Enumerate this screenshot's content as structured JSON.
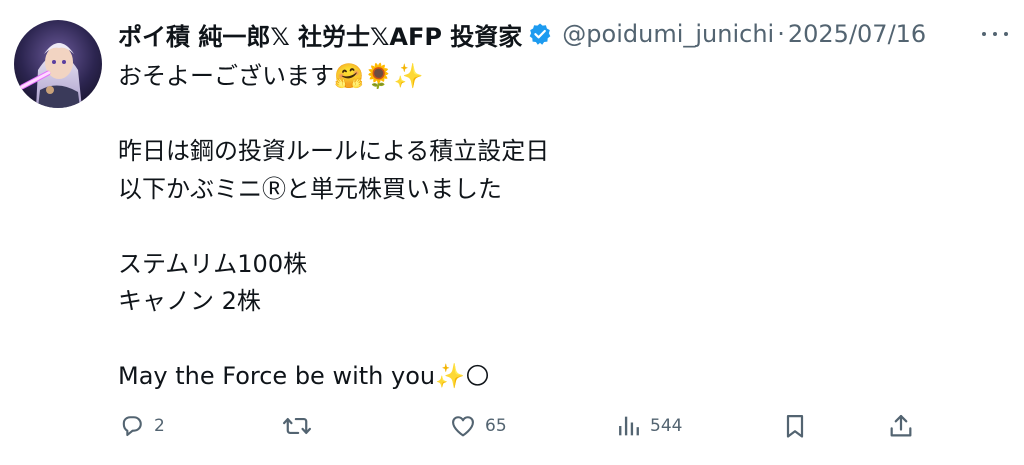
{
  "author": {
    "display_name": "ポイ積 純一郎𝕏 社労士𝕏AFP 投資家",
    "handle": "@poidumi_junichi",
    "separator": "·",
    "date": "2025/07/16",
    "verified": true
  },
  "post": {
    "text": "おそよーございます🤗🌻✨\n\n昨日は鋼の投資ルールによる積立設定日\n以下かぶミニⓇと単元株買いました\n\nステムリム100株\nキャノン 2株\n\nMay the Force be with you✨🌕"
  },
  "actions": {
    "reply": {
      "icon": "reply-icon",
      "count": "2"
    },
    "repost": {
      "icon": "repost-icon",
      "count": ""
    },
    "like": {
      "icon": "heart-icon",
      "count": "65"
    },
    "views": {
      "icon": "views-chart-icon",
      "count": "544"
    },
    "bookmark": {
      "icon": "bookmark-icon"
    },
    "share": {
      "icon": "share-icon"
    }
  },
  "colors": {
    "text": "#0f1419",
    "secondary": "#536471",
    "verified": "#1d9bf0"
  }
}
